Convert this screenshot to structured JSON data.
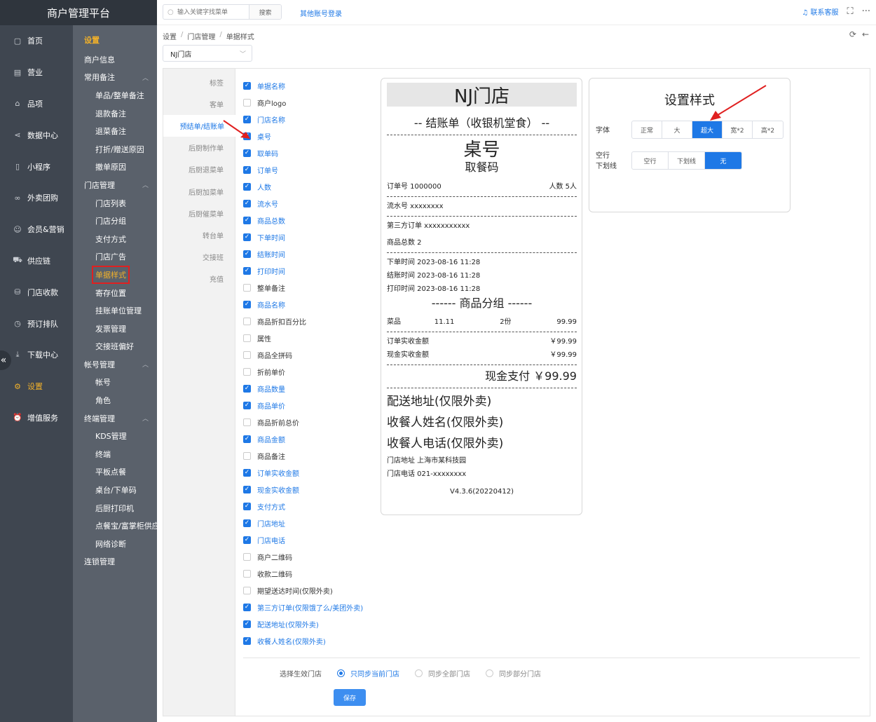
{
  "app_title": "商户管理平台",
  "nav": [
    {
      "label": "首页",
      "icon": "file-icon"
    },
    {
      "label": "营业",
      "icon": "calendar-icon"
    },
    {
      "label": "品项",
      "icon": "bag-icon"
    },
    {
      "label": "数据中心",
      "icon": "share-icon"
    },
    {
      "label": "小程序",
      "icon": "phone-icon"
    },
    {
      "label": "外卖团购",
      "icon": "bike-icon"
    },
    {
      "label": "会员&营销",
      "icon": "user-icon"
    },
    {
      "label": "供应链",
      "icon": "truck-icon"
    },
    {
      "label": "门店收款",
      "icon": "coins-icon"
    },
    {
      "label": "预订排队",
      "icon": "clock-icon"
    },
    {
      "label": "下载中心",
      "icon": "download-icon"
    },
    {
      "label": "设置",
      "icon": "gear-icon",
      "active": true
    },
    {
      "label": "增值服务",
      "icon": "alarm-icon"
    }
  ],
  "subnav": {
    "title": "设置",
    "items": [
      {
        "label": "商户信息",
        "level": 1
      },
      {
        "label": "常用备注",
        "level": 1,
        "group": true
      },
      {
        "label": "单品/整单备注",
        "level": 2
      },
      {
        "label": "退款备注",
        "level": 2
      },
      {
        "label": "退菜备注",
        "level": 2
      },
      {
        "label": "打折/赠送原因",
        "level": 2
      },
      {
        "label": "撤单原因",
        "level": 2
      },
      {
        "label": "门店管理",
        "level": 1,
        "group": true
      },
      {
        "label": "门店列表",
        "level": 2
      },
      {
        "label": "门店分组",
        "level": 2
      },
      {
        "label": "支付方式",
        "level": 2
      },
      {
        "label": "门店广告",
        "level": 2
      },
      {
        "label": "单据样式",
        "level": 2,
        "active": true
      },
      {
        "label": "寄存位置",
        "level": 2
      },
      {
        "label": "挂账单位管理",
        "level": 2
      },
      {
        "label": "发票管理",
        "level": 2
      },
      {
        "label": "交接班偏好",
        "level": 2
      },
      {
        "label": "帐号管理",
        "level": 1,
        "group": true
      },
      {
        "label": "帐号",
        "level": 2
      },
      {
        "label": "角色",
        "level": 2
      },
      {
        "label": "终端管理",
        "level": 1,
        "group": true
      },
      {
        "label": "KDS管理",
        "level": 2
      },
      {
        "label": "终端",
        "level": 2
      },
      {
        "label": "平板点餐",
        "level": 2
      },
      {
        "label": "桌台/下单码",
        "level": 2
      },
      {
        "label": "后厨打印机",
        "level": 2
      },
      {
        "label": "点餐宝/富掌柜供应",
        "level": 2
      },
      {
        "label": "网络诊断",
        "level": 2
      },
      {
        "label": "连锁管理",
        "level": 1
      }
    ]
  },
  "topbar": {
    "search_placeholder": "输入关键字找菜单",
    "search_btn": "搜索",
    "other_login": "其他账号登录",
    "contact": "联系客服",
    "expand_icon": "fullscreen-icon",
    "more_icon": "more-icon"
  },
  "breadcrumb": [
    "设置",
    "门店管理",
    "单据样式"
  ],
  "store_select": "NJ门店",
  "ticket_tabs": [
    {
      "label": "标签"
    },
    {
      "label": "客单"
    },
    {
      "label": "预结单/结账单",
      "active": true
    },
    {
      "label": "后厨制作单"
    },
    {
      "label": "后厨退菜单"
    },
    {
      "label": "后厨加菜单"
    },
    {
      "label": "后厨催菜单"
    },
    {
      "label": "转台单"
    },
    {
      "label": "交接班"
    },
    {
      "label": "充值"
    }
  ],
  "fields": [
    {
      "label": "单据名称",
      "on": true
    },
    {
      "label": "商户logo",
      "on": false
    },
    {
      "label": "门店名称",
      "on": true
    },
    {
      "label": "桌号",
      "on": true
    },
    {
      "label": "取单码",
      "on": true
    },
    {
      "label": "订单号",
      "on": true
    },
    {
      "label": "人数",
      "on": true
    },
    {
      "label": "流水号",
      "on": true
    },
    {
      "label": "商品总数",
      "on": true
    },
    {
      "label": "下单时间",
      "on": true
    },
    {
      "label": "结账时间",
      "on": true
    },
    {
      "label": "打印时间",
      "on": true
    },
    {
      "label": "整单备注",
      "on": false
    },
    {
      "label": "商品名称",
      "on": true
    },
    {
      "label": "商品折扣百分比",
      "on": false
    },
    {
      "label": "属性",
      "on": false
    },
    {
      "label": "商品全拼码",
      "on": false
    },
    {
      "label": "折前单价",
      "on": false
    },
    {
      "label": "商品数量",
      "on": true
    },
    {
      "label": "商品单价",
      "on": true
    },
    {
      "label": "商品折前总价",
      "on": false
    },
    {
      "label": "商品金额",
      "on": true
    },
    {
      "label": "商品备注",
      "on": false
    },
    {
      "label": "订单实收金额",
      "on": true
    },
    {
      "label": "现金实收金额",
      "on": true
    },
    {
      "label": "支付方式",
      "on": true
    },
    {
      "label": "门店地址",
      "on": true
    },
    {
      "label": "门店电话",
      "on": true
    },
    {
      "label": "商户二维码",
      "on": false
    },
    {
      "label": "收款二维码",
      "on": false
    },
    {
      "label": "期望送达时间(仅限外卖)",
      "on": false
    },
    {
      "label": "第三方订单(仅限饿了么/美团外卖)",
      "on": true
    },
    {
      "label": "配送地址(仅限外卖)",
      "on": true
    },
    {
      "label": "收餐人姓名(仅限外卖)",
      "on": true
    }
  ],
  "receipt": {
    "store": "NJ门店",
    "bill_title": "-- 结账单（收银机堂食） --",
    "table_no": "桌号",
    "pickup_code": "取餐码",
    "order_no": "订单号 1000000",
    "guests": "人数 5人",
    "serial": "流水号 xxxxxxxx",
    "third_party": "第三方订单 xxxxxxxxxxx",
    "total_items": "商品总数 2",
    "order_time": "下单时间 2023-08-16 11:28",
    "checkout_time": "结账时间 2023-08-16 11:28",
    "print_time": "打印时间 2023-08-16 11:28",
    "group": "------ 商品分组 ------",
    "item": {
      "name": "菜品",
      "price": "11.11",
      "qty": "2份",
      "amount": "99.99"
    },
    "order_paid_label": "订单实收金额",
    "order_paid": "￥99.99",
    "cash_paid_label": "现金实收金额",
    "cash_paid": "￥99.99",
    "pay_line": "现金支付 ￥99.99",
    "delivery_addr": "配送地址(仅限外卖)",
    "recipient_name": "收餐人姓名(仅限外卖)",
    "recipient_phone": "收餐人电话(仅限外卖)",
    "store_addr": "门店地址 上海市某科技园",
    "store_phone": "门店电话 021-xxxxxxxx",
    "version": "V4.3.6(20220412)"
  },
  "style_settings": {
    "title": "设置样式",
    "font_label": "字体",
    "font_options": [
      {
        "label": "正常"
      },
      {
        "label": "大"
      },
      {
        "label": "超大",
        "on": true
      },
      {
        "label": "宽*2"
      },
      {
        "label": "高*2"
      }
    ],
    "blank_label_1": "空行",
    "blank_label_2": "下划线",
    "blank_options": [
      {
        "label": "空行"
      },
      {
        "label": "下划线"
      },
      {
        "label": "无",
        "on": true
      }
    ]
  },
  "sync": {
    "label": "选择生效门店",
    "options": [
      {
        "label": "只同步当前门店",
        "on": true
      },
      {
        "label": "同步全部门店"
      },
      {
        "label": "同步部分门店"
      }
    ]
  },
  "save_btn": "保存",
  "colors": {
    "accent": "#1e78e6",
    "nav_bg": "#3f4650",
    "subnav_bg": "#5a616b",
    "active_nav": "#f0b02a",
    "annotation": "#e02020"
  }
}
